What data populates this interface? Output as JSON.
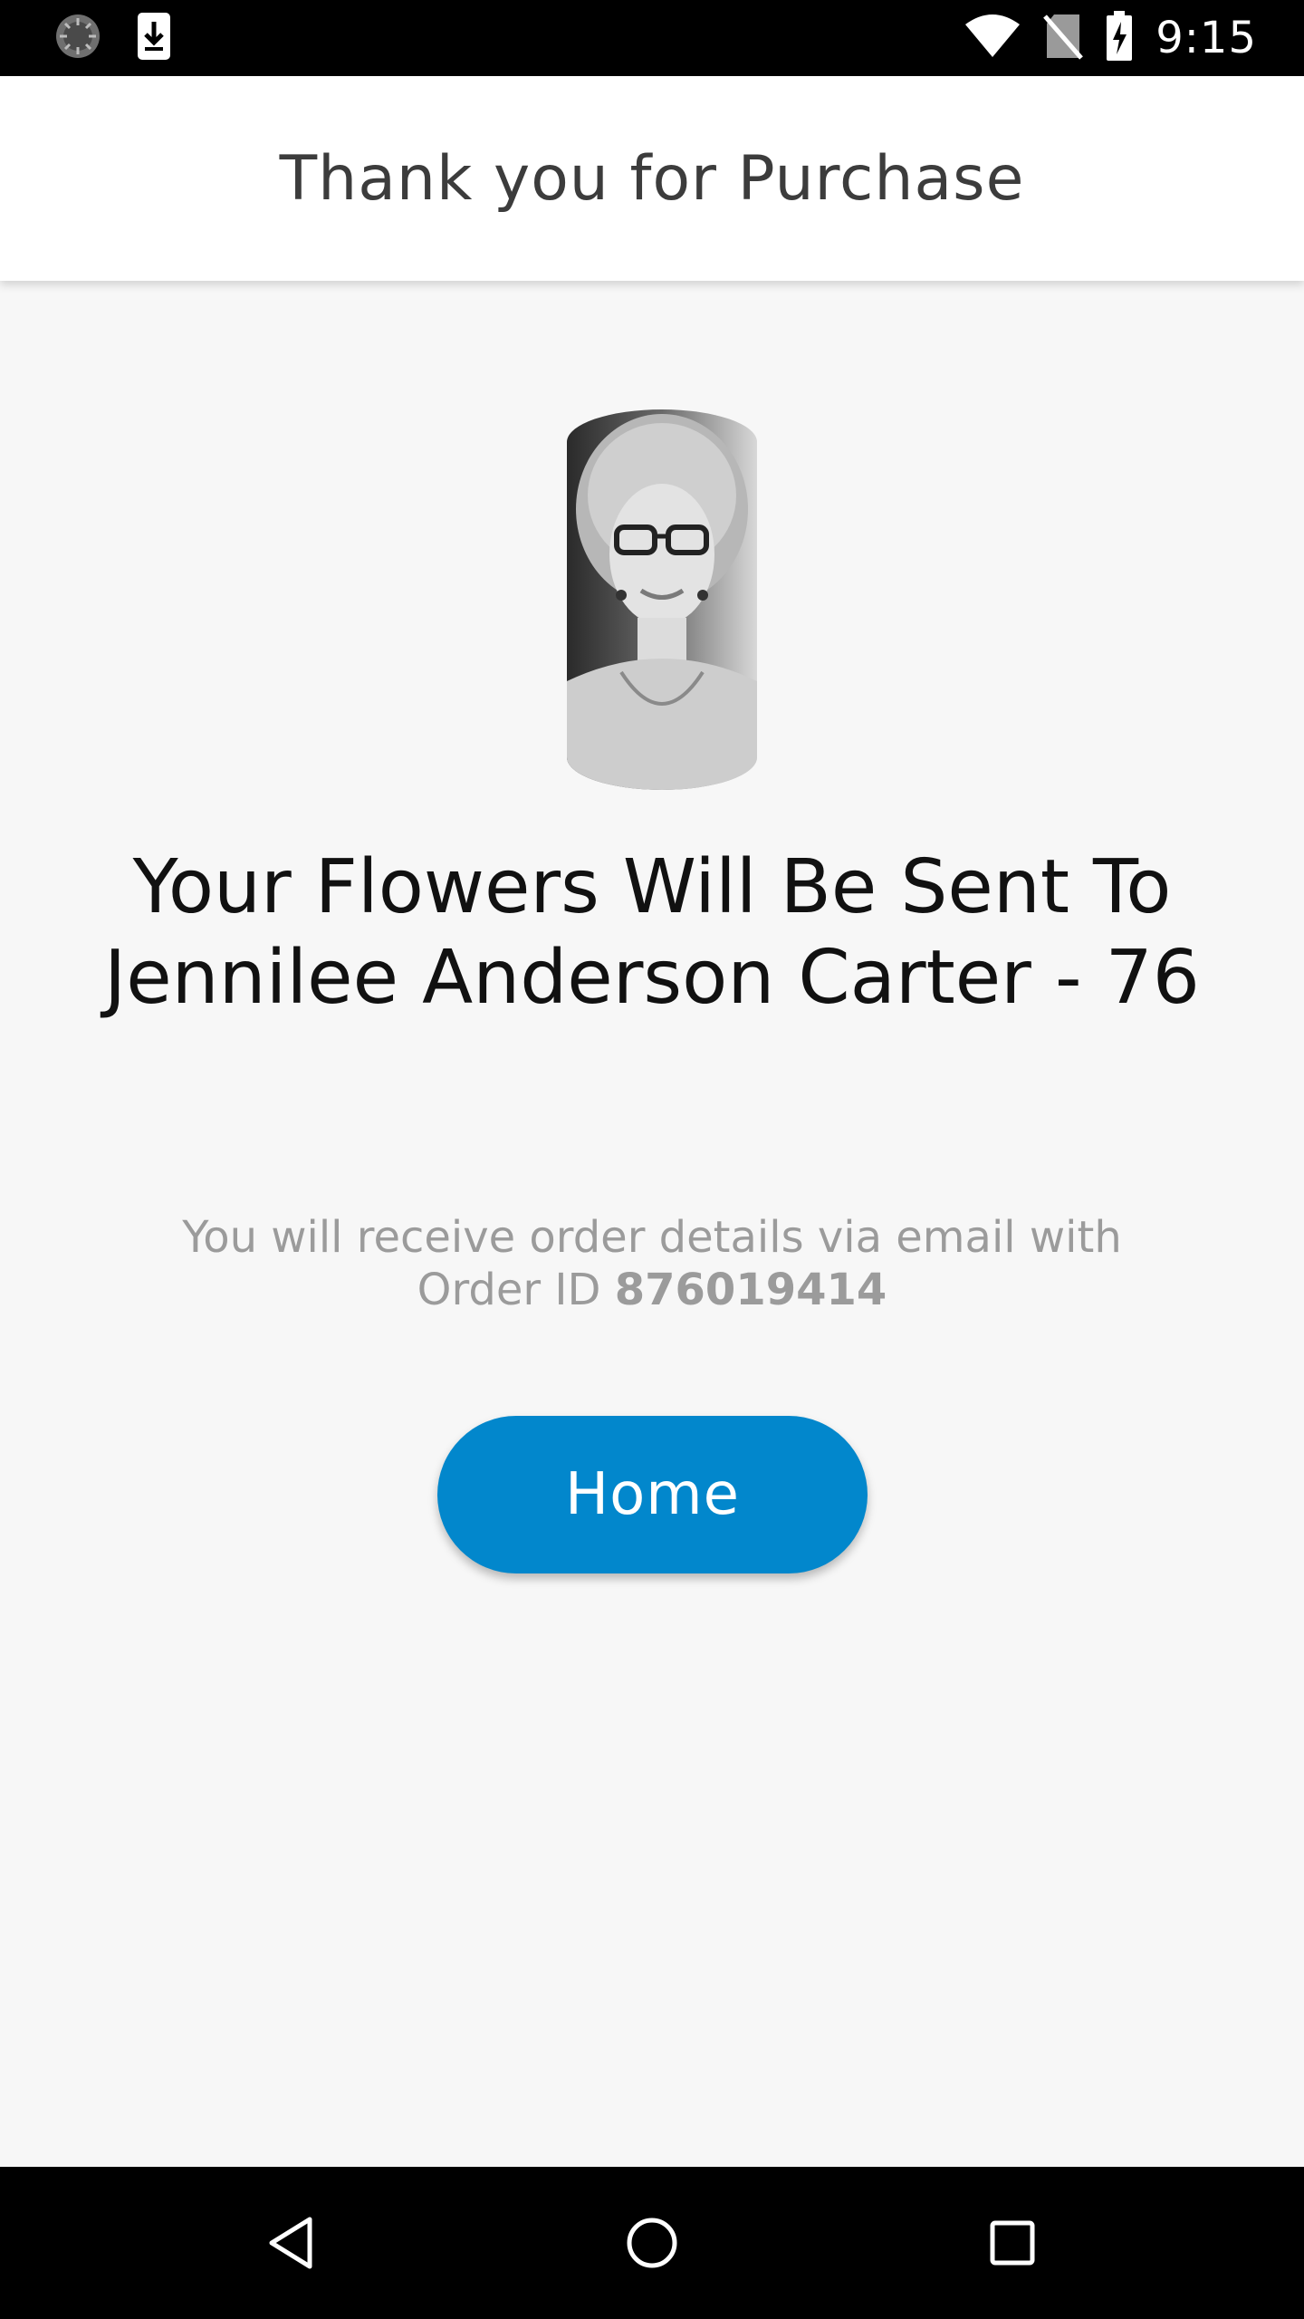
{
  "status_bar": {
    "time": "9:15",
    "icons": [
      "sync-icon",
      "download-icon",
      "wifi-icon",
      "no-sim-icon",
      "battery-charging-icon"
    ]
  },
  "app_bar": {
    "title": "Thank you for Purchase"
  },
  "confirmation": {
    "portrait_alt": "portrait-photo",
    "headline": "Your Flowers Will Be Sent To Jennilee Anderson Carter - 76",
    "info_prefix": "You will receive order details via email with Order ID ",
    "order_id": "876019414",
    "home_label": "Home"
  },
  "nav_bar": {
    "icons": [
      "back-icon",
      "home-nav-icon",
      "recents-icon"
    ]
  },
  "colors": {
    "accent": "#0287cc",
    "background": "#f7f7f7",
    "bar": "#000000"
  }
}
